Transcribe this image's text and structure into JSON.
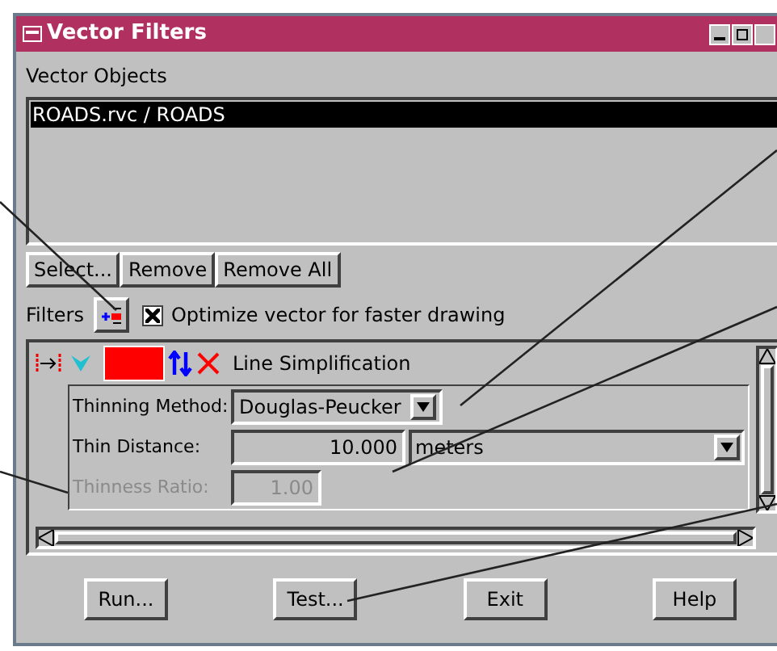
{
  "window": {
    "title": "Vector Filters"
  },
  "vector_objects": {
    "label": "Vector Objects",
    "items": [
      {
        "text": "ROADS.rvc / ROADS",
        "selected": true
      }
    ]
  },
  "list_buttons": [
    "Select...",
    "Remove",
    "Remove All"
  ],
  "filters": {
    "label": "Filters",
    "optimize": {
      "label": "Optimize vector for faster drawing",
      "checked": true
    }
  },
  "filter": {
    "title": "Line Simplification",
    "color": "#ff0000",
    "fields": [
      {
        "kind": "dropdown",
        "label": "Thinning Method:",
        "value": "Douglas-Peucker",
        "disabled": false
      },
      {
        "kind": "number_unit",
        "label": "Thin Distance:",
        "value": "10.000",
        "unit": "meters",
        "disabled": false
      },
      {
        "kind": "number",
        "label": "Thinness Ratio:",
        "value": "1.00",
        "disabled": true
      }
    ]
  },
  "buttons": [
    "Run...",
    "Test...",
    "Exit",
    "Help"
  ]
}
